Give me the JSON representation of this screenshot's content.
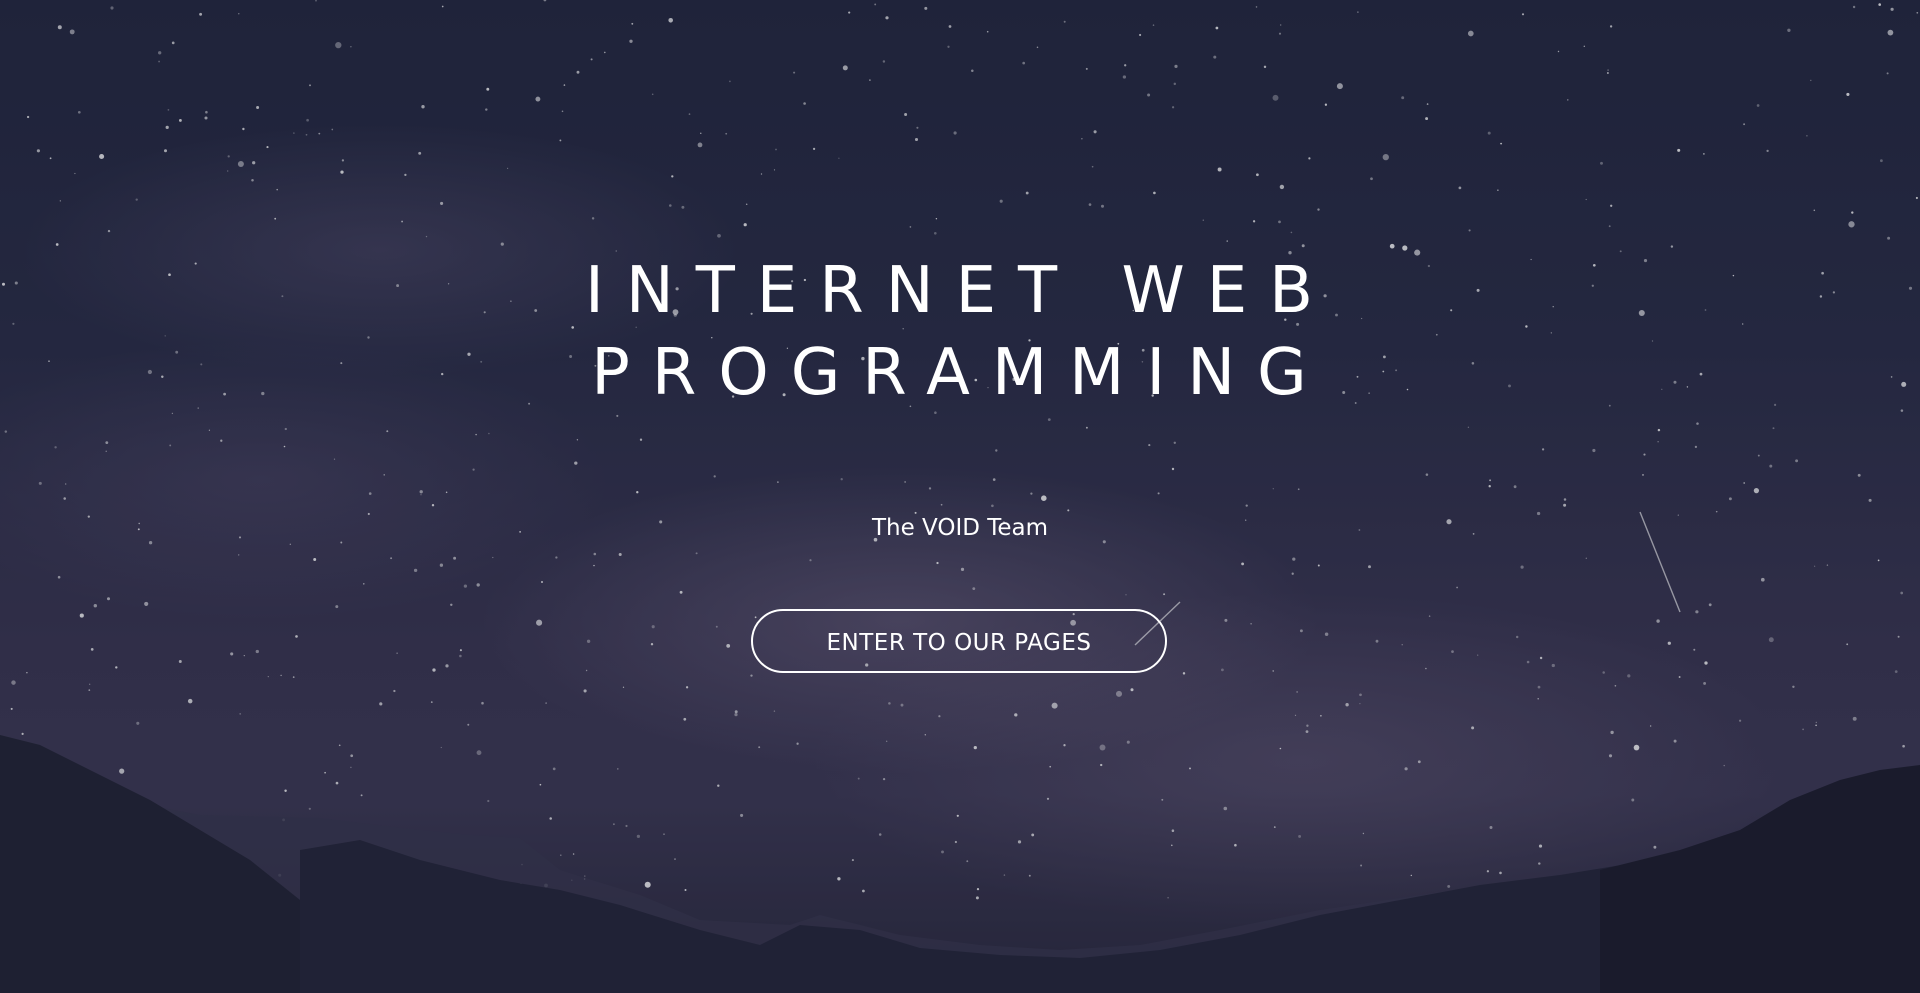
{
  "hero": {
    "title_line_1": "INTERNET WEB",
    "title_line_2": "PROGRAMMING",
    "subtitle": "The VOID Team",
    "enter_button_label": "ENTER TO OUR PAGES"
  },
  "background": {
    "description_icon": "starry-night-mountains-icon",
    "sky_color": "#2a2d47",
    "milky_way_color": "#8a7a9a",
    "mountain_color": "#1f2030",
    "text_color": "#ffffff"
  }
}
